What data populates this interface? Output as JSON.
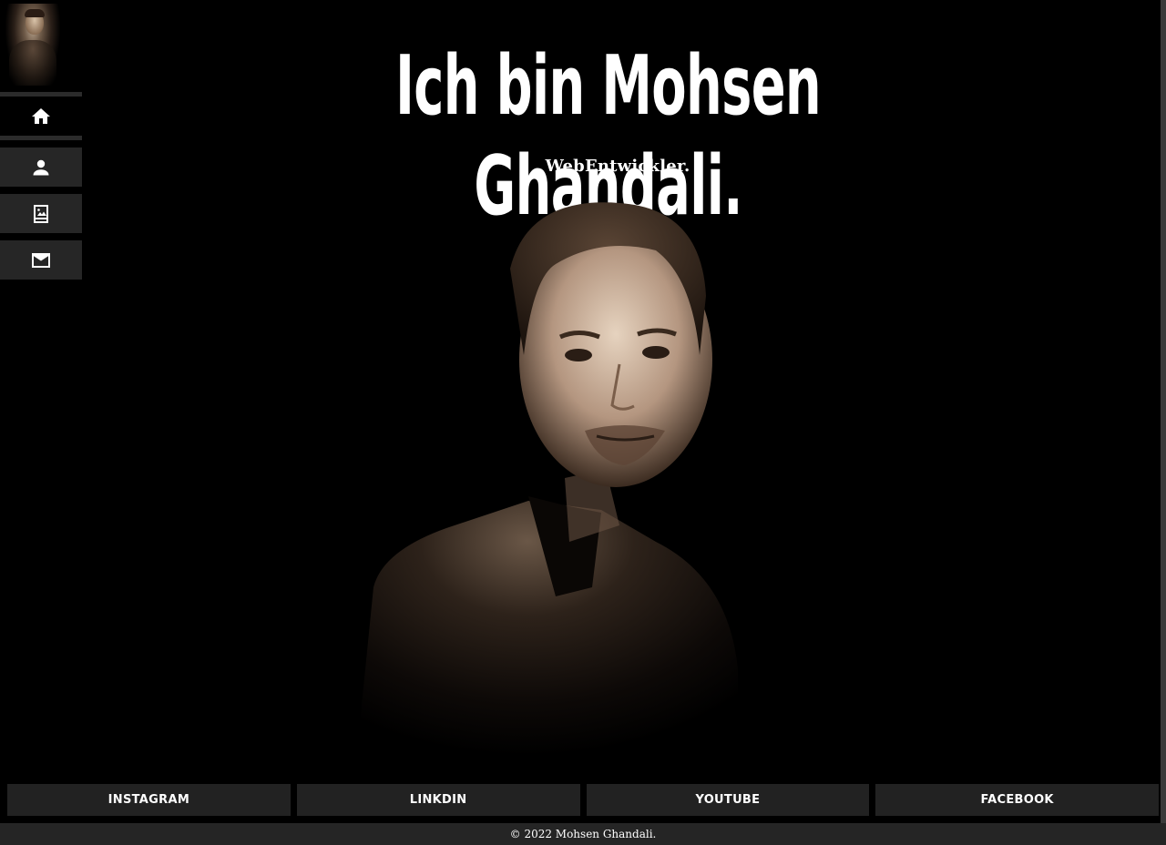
{
  "hero": {
    "title": "Ich bin Mohsen Ghandali.",
    "subtitle": "WebEntwickler."
  },
  "sidebar": {
    "items": [
      {
        "icon": "home-icon",
        "name": "nav-home"
      },
      {
        "icon": "user-icon",
        "name": "nav-about"
      },
      {
        "icon": "gallery-icon",
        "name": "nav-portfolio"
      },
      {
        "icon": "mail-icon",
        "name": "nav-contact"
      }
    ]
  },
  "social": {
    "instagram": "INSTAGRAM",
    "linkedin": "LINKDIN",
    "youtube": "YOUTUBE",
    "facebook": "FACEBOOK"
  },
  "footer": {
    "copyright": "© 2022 Mohsen Ghandali."
  },
  "colors": {
    "background": "#000000",
    "nav_inactive": "#262626",
    "button": "#222222",
    "footer": "#252525",
    "text": "#ffffff"
  }
}
